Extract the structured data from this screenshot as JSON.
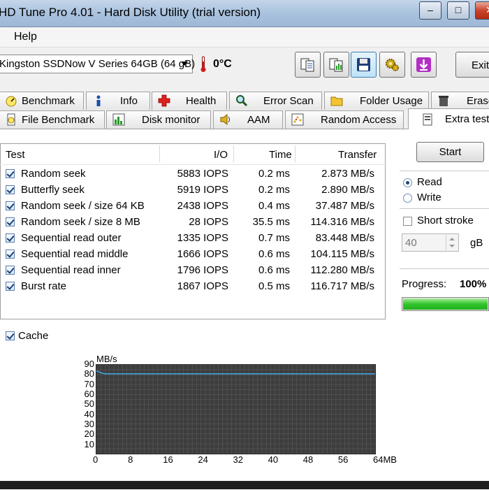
{
  "window": {
    "title": "HD Tune Pro 4.01 - Hard Disk Utility (trial version)",
    "min": "–",
    "max": "□",
    "close": "✕"
  },
  "menu": {
    "help": "Help"
  },
  "toolbar": {
    "drive": "Kingston SSDNow V Series 64GB (64 gB)",
    "temperature": "0°C",
    "exit": "Exit"
  },
  "tabs_row1": [
    "Benchmark",
    "Info",
    "Health",
    "Error Scan",
    "Folder Usage",
    "Erase"
  ],
  "tabs_row2": [
    "File Benchmark",
    "Disk monitor",
    "AAM",
    "Random Access",
    "Extra tests"
  ],
  "table": {
    "headers": {
      "test": "Test",
      "io": "I/O",
      "time": "Time",
      "transfer": "Transfer"
    },
    "rows": [
      {
        "test": "Random seek",
        "io": "5883 IOPS",
        "time": "0.2 ms",
        "transfer": "2.873 MB/s"
      },
      {
        "test": "Butterfly seek",
        "io": "5919 IOPS",
        "time": "0.2 ms",
        "transfer": "2.890 MB/s"
      },
      {
        "test": "Random seek / size 64 KB",
        "io": "2438 IOPS",
        "time": "0.4 ms",
        "transfer": "37.487 MB/s"
      },
      {
        "test": "Random seek / size 8 MB",
        "io": "28 IOPS",
        "time": "35.5 ms",
        "transfer": "114.316 MB/s"
      },
      {
        "test": "Sequential read outer",
        "io": "1335 IOPS",
        "time": "0.7 ms",
        "transfer": "83.448 MB/s"
      },
      {
        "test": "Sequential read middle",
        "io": "1666 IOPS",
        "time": "0.6 ms",
        "transfer": "104.115 MB/s"
      },
      {
        "test": "Sequential read inner",
        "io": "1796 IOPS",
        "time": "0.6 ms",
        "transfer": "112.280 MB/s"
      },
      {
        "test": "Burst rate",
        "io": "1867 IOPS",
        "time": "0.5 ms",
        "transfer": "116.717 MB/s"
      }
    ]
  },
  "controls": {
    "start": "Start",
    "read": "Read",
    "write": "Write",
    "short_stroke": "Short stroke",
    "size_value": "40",
    "size_unit": "gB",
    "progress_label": "Progress:",
    "progress_value": "100%",
    "progress_fraction": 1.0,
    "cache": "Cache"
  },
  "chart_data": {
    "type": "line",
    "ylabel": "MB/s",
    "xlabel": "MB",
    "ylim": [
      0,
      90
    ],
    "xlim": [
      0,
      64
    ],
    "yticks": [
      "90",
      "80",
      "70",
      "60",
      "50",
      "40",
      "30",
      "20",
      "10"
    ],
    "xticks": [
      "0",
      "8",
      "16",
      "24",
      "32",
      "40",
      "48",
      "56",
      "64MB"
    ],
    "grid": true,
    "series": [
      {
        "x": [
          0,
          1,
          2,
          4,
          8,
          16,
          24,
          32,
          40,
          48,
          56,
          64
        ],
        "values": [
          84,
          82,
          81,
          81,
          81,
          81,
          81,
          81,
          81,
          81,
          81,
          81
        ]
      }
    ]
  }
}
